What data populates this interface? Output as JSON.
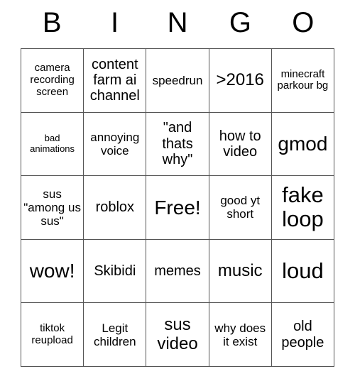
{
  "card": {
    "header_letters": [
      "B",
      "I",
      "N",
      "G",
      "O"
    ],
    "rows": [
      [
        {
          "text": "camera recording screen",
          "size": "fs-sm"
        },
        {
          "text": "content farm ai channel",
          "size": "fs-lg"
        },
        {
          "text": "speedrun",
          "size": "fs-md"
        },
        {
          "text": ">2016",
          "size": "fs-xl"
        },
        {
          "text": "minecraft parkour bg",
          "size": "fs-sm"
        }
      ],
      [
        {
          "text": "bad animations",
          "size": "fs-xs"
        },
        {
          "text": "annoying voice",
          "size": "fs-md"
        },
        {
          "text": "\"and thats why\"",
          "size": "fs-lg"
        },
        {
          "text": "how to video",
          "size": "fs-lg"
        },
        {
          "text": "gmod",
          "size": "fs-2xl"
        }
      ],
      [
        {
          "text": "sus \"among us sus\"",
          "size": "fs-md"
        },
        {
          "text": "roblox",
          "size": "fs-lg"
        },
        {
          "text": "Free!",
          "size": "fs-2xl"
        },
        {
          "text": "good yt short",
          "size": "fs-md"
        },
        {
          "text": "fake loop",
          "size": "fs-3xl"
        }
      ],
      [
        {
          "text": "wow!",
          "size": "fs-2xl"
        },
        {
          "text": "Skibidi",
          "size": "fs-lg"
        },
        {
          "text": "memes",
          "size": "fs-lg"
        },
        {
          "text": "music",
          "size": "fs-xl"
        },
        {
          "text": "loud",
          "size": "fs-3xl"
        }
      ],
      [
        {
          "text": "tiktok reupload",
          "size": "fs-sm"
        },
        {
          "text": "Legit children",
          "size": "fs-md"
        },
        {
          "text": "sus video",
          "size": "fs-xl"
        },
        {
          "text": "why does it exist",
          "size": "fs-md"
        },
        {
          "text": "old people",
          "size": "fs-lg"
        }
      ]
    ]
  }
}
